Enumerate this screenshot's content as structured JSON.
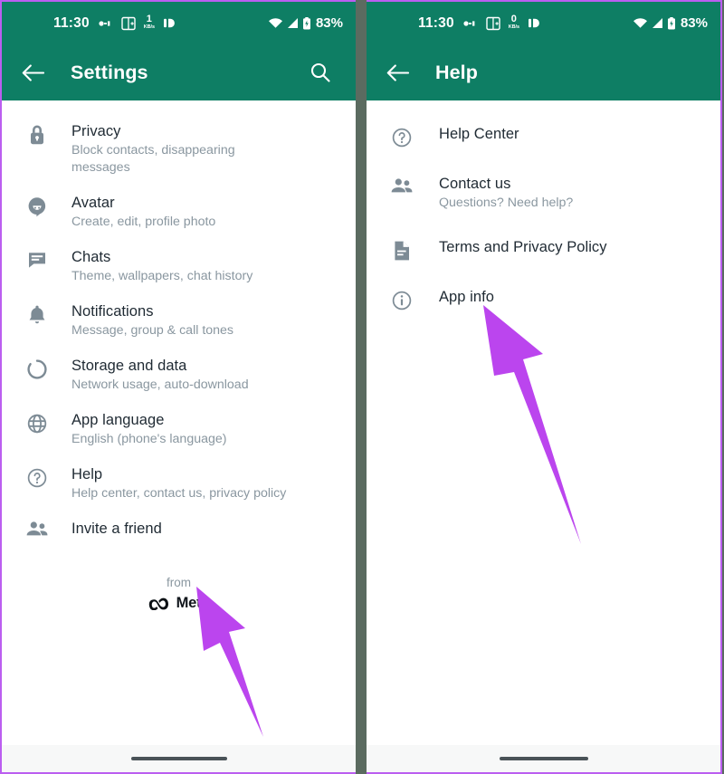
{
  "theme": {
    "header_green": "#0e7e64",
    "arrow_purple": "#bb45ee",
    "panel_border": "#bb5ef0",
    "title_text": "#1f2a33",
    "subtitle_text": "#8a97a0",
    "icon_gray": "#7d8b95"
  },
  "left_panel": {
    "status_bar": {
      "clock": "11:30",
      "vpn_icon": "vpn-key-icon",
      "screenshot_icon": "screen-capture-icon",
      "data_rate_value": "1",
      "data_rate_unit": "KB/s",
      "dnd_icon": "do-not-disturb-icon",
      "wifi_icon": "wifi-icon",
      "signal_icon": "cellular-signal-icon",
      "battery_icon": "battery-icon",
      "battery_text": "83%"
    },
    "app_bar": {
      "back_icon": "back-arrow-icon",
      "title": "Settings",
      "search_icon": "search-icon"
    },
    "items": [
      {
        "icon": "lock-icon",
        "title": "Privacy",
        "subtitle": "Block contacts, disappearing messages"
      },
      {
        "icon": "avatar-icon",
        "title": "Avatar",
        "subtitle": "Create, edit, profile photo"
      },
      {
        "icon": "chat-icon",
        "title": "Chats",
        "subtitle": "Theme, wallpapers, chat history"
      },
      {
        "icon": "bell-icon",
        "title": "Notifications",
        "subtitle": "Message, group & call tones"
      },
      {
        "icon": "storage-icon",
        "title": "Storage and data",
        "subtitle": "Network usage, auto-download"
      },
      {
        "icon": "globe-icon",
        "title": "App language",
        "subtitle": "English (phone's language)"
      },
      {
        "icon": "help-icon",
        "title": "Help",
        "subtitle": "Help center, contact us, privacy policy"
      },
      {
        "icon": "people-icon",
        "title": "Invite a friend",
        "subtitle": ""
      }
    ],
    "footer": {
      "from_label": "from",
      "brand_logo": "meta-infinity-logo",
      "brand_name": "Meta"
    },
    "nav_bar": {
      "gesture_pill": "home-gesture-pill"
    }
  },
  "right_panel": {
    "status_bar": {
      "clock": "11:30",
      "vpn_icon": "vpn-key-icon",
      "screenshot_icon": "screen-capture-icon",
      "data_rate_value": "0",
      "data_rate_unit": "KB/s",
      "dnd_icon": "do-not-disturb-icon",
      "wifi_icon": "wifi-icon",
      "signal_icon": "cellular-signal-icon",
      "battery_icon": "battery-icon",
      "battery_text": "83%"
    },
    "app_bar": {
      "back_icon": "back-arrow-icon",
      "title": "Help"
    },
    "items": [
      {
        "icon": "help-icon",
        "title": "Help Center",
        "subtitle": ""
      },
      {
        "icon": "people-icon",
        "title": "Contact us",
        "subtitle": "Questions? Need help?"
      },
      {
        "icon": "document-icon",
        "title": "Terms and Privacy Policy",
        "subtitle": ""
      },
      {
        "icon": "info-icon",
        "title": "App info",
        "subtitle": ""
      }
    ],
    "nav_bar": {
      "gesture_pill": "home-gesture-pill"
    }
  },
  "annotations": [
    {
      "name": "arrow-pointing-to-help",
      "target": "Help"
    },
    {
      "name": "arrow-pointing-to-app-info",
      "target": "App info"
    }
  ]
}
